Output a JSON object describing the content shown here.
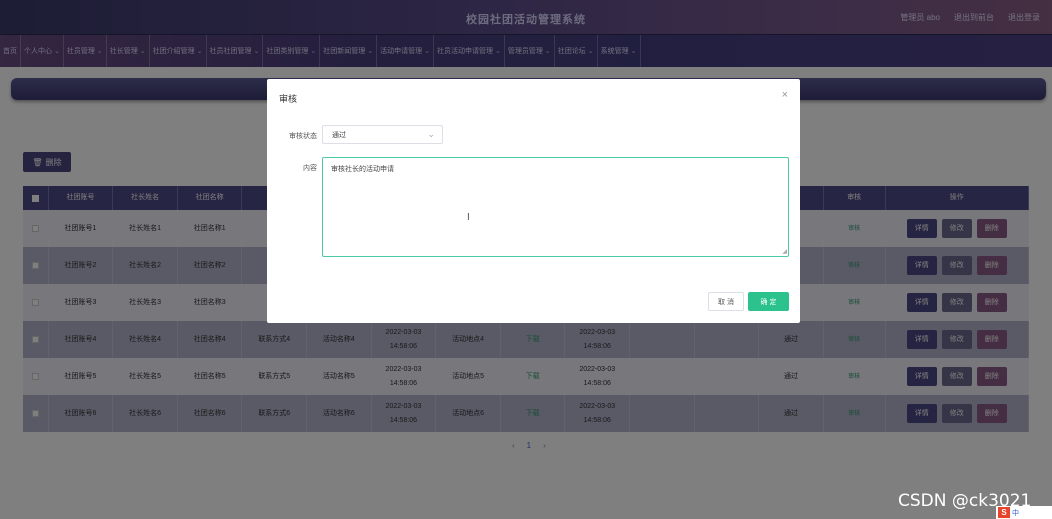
{
  "header": {
    "title": "校园社团活动管理系统",
    "user_label": "管理员 abo",
    "exit_to_front": "退出到前台",
    "logout": "退出登录"
  },
  "nav": {
    "items": [
      {
        "label": "首页",
        "has_dropdown": false
      },
      {
        "label": "个人中心",
        "has_dropdown": true
      },
      {
        "label": "社员管理",
        "has_dropdown": true
      },
      {
        "label": "社长管理",
        "has_dropdown": true
      },
      {
        "label": "社团介绍管理",
        "has_dropdown": true
      },
      {
        "label": "社员社团管理",
        "has_dropdown": true
      },
      {
        "label": "社团类别管理",
        "has_dropdown": true
      },
      {
        "label": "社团新闻管理",
        "has_dropdown": true
      },
      {
        "label": "活动申请管理",
        "has_dropdown": true
      },
      {
        "label": "社员活动申请管理",
        "has_dropdown": true
      },
      {
        "label": "管理员管理",
        "has_dropdown": true
      },
      {
        "label": "社团论坛",
        "has_dropdown": true
      },
      {
        "label": "系统管理",
        "has_dropdown": true
      }
    ]
  },
  "toolbar": {
    "delete_label": "删除"
  },
  "table": {
    "headers": [
      "",
      "社团账号",
      "社长姓名",
      "社团名称",
      "",
      "",
      "",
      "",
      "",
      "",
      "",
      "",
      "",
      "审核",
      "操作"
    ],
    "rows": [
      {
        "c1": "社团账号1",
        "c2": "社长姓名1",
        "c3": "社团名称1",
        "c4": "",
        "c5": "",
        "c6": "",
        "c7": "",
        "c8": "",
        "c9": "",
        "c10": "",
        "c11": "",
        "c12": "",
        "audit": "审核"
      },
      {
        "c1": "社团账号2",
        "c2": "社长姓名2",
        "c3": "社团名称2",
        "c4": "",
        "c5": "",
        "c6": "",
        "c7": "",
        "c8": "",
        "c9": "",
        "c10": "",
        "c11": "",
        "c12": "",
        "audit": "审核"
      },
      {
        "c1": "社团账号3",
        "c2": "社长姓名3",
        "c3": "社团名称3",
        "c4": "",
        "c5": "",
        "c6": "",
        "c7": "",
        "c8": "",
        "c9": "",
        "c10": "",
        "c11": "",
        "c12": "",
        "audit": "审核"
      },
      {
        "c1": "社团账号4",
        "c2": "社长姓名4",
        "c3": "社团名称4",
        "c4": "联系方式4",
        "c5": "活动名称4",
        "c6": "2022-03-03 14:58:06",
        "c7": "活动地点4",
        "c8": "下载",
        "c9": "2022-03-03 14:58:06",
        "c10": "",
        "c11": "",
        "c12": "通过",
        "audit": "审核"
      },
      {
        "c1": "社团账号5",
        "c2": "社长姓名5",
        "c3": "社团名称5",
        "c4": "联系方式5",
        "c5": "活动名称5",
        "c6": "2022-03-03 14:58:06",
        "c7": "活动地点5",
        "c8": "下载",
        "c9": "2022-03-03 14:58:06",
        "c10": "",
        "c11": "",
        "c12": "通过",
        "audit": "审核"
      },
      {
        "c1": "社团账号6",
        "c2": "社长姓名6",
        "c3": "社团名称6",
        "c4": "联系方式6",
        "c5": "活动名称6",
        "c6": "2022-03-03 14:58:06",
        "c7": "活动地点6",
        "c8": "下载",
        "c9": "2022-03-03 14:58:06",
        "c10": "",
        "c11": "",
        "c12": "通过",
        "audit": "审核"
      }
    ],
    "op_detail": "详情",
    "op_edit": "修改",
    "op_delete": "删除"
  },
  "pager": {
    "prev": "‹",
    "current": "1",
    "next": "›"
  },
  "modal": {
    "title": "审核",
    "close": "×",
    "status_label": "审核状态",
    "status_value": "通过",
    "content_label": "内容",
    "content_value": "审核社长的活动申请",
    "cancel_label": "取 消",
    "confirm_label": "确 定"
  },
  "watermark": "CSDN @ck3021",
  "tray": {
    "ime_logo": "S",
    "ime_lang": "中"
  }
}
